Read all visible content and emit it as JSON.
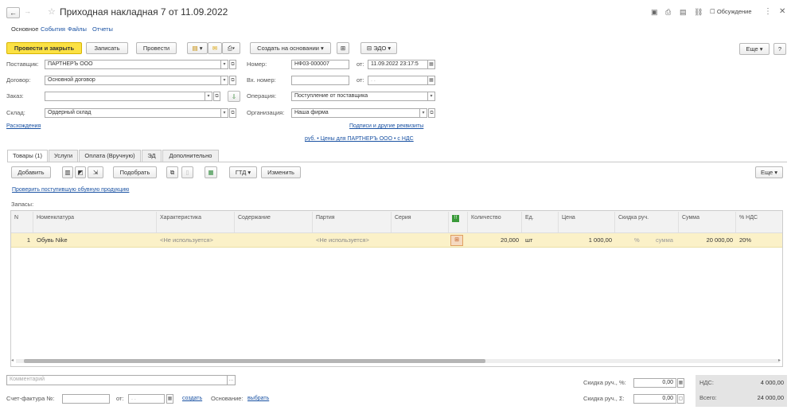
{
  "window": {
    "title": "Приходная накладная 7 от 11.09.2022",
    "discussion": "Обсуждение"
  },
  "nav_tabs": [
    "Основное",
    "События",
    "Файлы",
    "Отчеты"
  ],
  "toolbar": {
    "post_close": "Провести и закрыть",
    "save": "Записать",
    "post": "Провести",
    "create_based": "Создать на основании",
    "edo": "ЭДО",
    "more": "Еще",
    "help": "?"
  },
  "form": {
    "supplier_label": "Поставщик:",
    "supplier_value": "ПАРТНЕРЪ ООО",
    "contract_label": "Договор:",
    "contract_value": "Основной договор",
    "order_label": "Заказ:",
    "order_value": "",
    "warehouse_label": "Склад:",
    "warehouse_value": "Ордерный склад",
    "number_label": "Номер:",
    "number_value": "НФ03-000007",
    "date_from_label": "от:",
    "date_value": "11.09.2022 23:17:5",
    "in_number_label": "Вх. номер:",
    "in_number_value": "",
    "in_date_label": "от:",
    "in_date_value": " .  .",
    "operation_label": "Операция:",
    "operation_value": "Поступление от поставщика",
    "org_label": "Организация:",
    "org_value": "Наша фирма",
    "discrepancies_link": "Расхождения",
    "signatures_link": "Подписи и другие реквизиты",
    "prices_link": "руб. • Цены для ПАРТНЕРЪ ООО • с НДС"
  },
  "tabs": [
    "Товары (1)",
    "Услуги",
    "Оплата (Вручную)",
    "ЭД",
    "Дополнительно"
  ],
  "goods_toolbar": {
    "add": "Добавить",
    "select": "Подобрать",
    "gtd": "ГТД",
    "change": "Изменить",
    "more": "Еще"
  },
  "check_link": "Проверить поступившую обувную продукцию",
  "stock_label": "Запасы:",
  "table": {
    "headers": [
      "N",
      "Номенклатура",
      "Характеристика",
      "Содержание",
      "Партия",
      "Серия",
      "",
      "Количество",
      "Ед.",
      "Цена",
      "Скидка руч.",
      "Сумма",
      "% НДС"
    ],
    "rows": [
      {
        "n": "1",
        "item": "Обувь Nike",
        "characteristic": "<Не используется>",
        "content": "",
        "batch": "<Не используется>",
        "series": "",
        "qty": "20,000",
        "unit": "шт",
        "price": "1 000,00",
        "disc_pct": "%",
        "disc_sum": "сумма",
        "sum": "20 000,00",
        "vat": "20%"
      }
    ]
  },
  "footer": {
    "comment_placeholder": "Комментарий",
    "invoice_label": "Счет-фактура №:",
    "invoice_from": "от:",
    "invoice_date": " .  .",
    "create_link": "создать",
    "basis_label": "Основание:",
    "choose_link": "выбрать",
    "disc_pct_label": "Скидка руч., %:",
    "disc_pct_value": "0,00",
    "disc_sum_label": "Скидка руч., Σ:",
    "disc_sum_value": "0,00",
    "vat_label": "НДС:",
    "vat_value": "4 000,00",
    "total_label": "Всего:",
    "total_value": "24 000,00"
  },
  "colors": {
    "accent_yellow": "#fbe143",
    "link_blue": "#1a52a3",
    "row_selected": "#fbf1c8"
  }
}
